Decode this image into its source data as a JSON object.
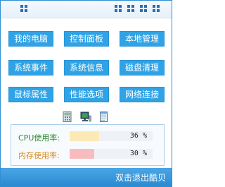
{
  "buttons": [
    {
      "label": "我的电脑"
    },
    {
      "label": "控制面板"
    },
    {
      "label": "本地管理"
    },
    {
      "label": "系统事件"
    },
    {
      "label": "系统信息"
    },
    {
      "label": "磁盘清理"
    },
    {
      "label": "鼠标属性"
    },
    {
      "label": "性能选项"
    },
    {
      "label": "网络连接"
    }
  ],
  "monitor": {
    "cpu": {
      "label": "CPU使用率:",
      "value": "36 %",
      "percent": 36,
      "label_color": "#2a8a2a",
      "fill_color": "#fde9b6"
    },
    "mem": {
      "label": "内存使用率:",
      "value": "30 %",
      "percent": 30,
      "label_color": "#d88a20",
      "fill_color": "#f8bcc0"
    }
  },
  "footer": {
    "text": "双击退出酷贝"
  },
  "colors": {
    "accent": "#2fa3e6",
    "footer": "#2b8ad1"
  },
  "icons": [
    "window-grid-icon",
    "grid-view-icon-1",
    "grid-view-icon-2",
    "grid-view-icon-3",
    "grid-view-icon-4",
    "calculator-icon",
    "computer-icon",
    "notepad-icon"
  ]
}
